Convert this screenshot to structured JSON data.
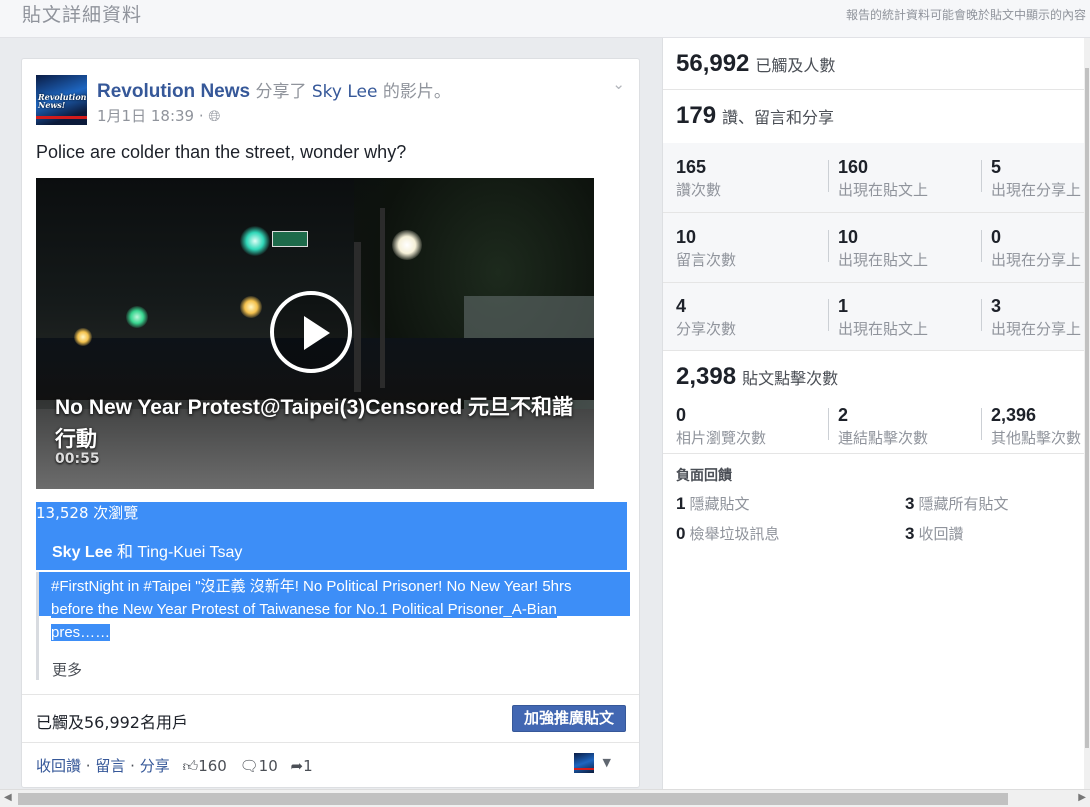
{
  "header": {
    "title": "貼文詳細資料",
    "note": "報告的統計資料可能會晚於貼文中顯示的內容"
  },
  "post": {
    "page_name": "Revolution News",
    "shared_text": "分享了",
    "shared_user": "Sky Lee",
    "shared_suffix": "的影片。",
    "date": "1月1日 18:39 ·",
    "message": "Police are colder than the street, wonder why?",
    "avatar_text": "Revolution\nNews!",
    "video": {
      "title": "No New Year Protest@Taipei(3)Censored 元旦不和諧行動",
      "duration": "00:55",
      "views": "13,528 次瀏覽"
    },
    "tagged": {
      "first": "Sky Lee",
      "joiner": "和",
      "second": "Ting-Kuei Tsay"
    },
    "description_line1": "#FirstNight in #Taipei \"沒正義 沒新年! No Political Prisoner! No New Year! 5hrs",
    "description_line2": "before the New Year Protest of Taiwanese for No.1 Political Prisoner_A-Bian",
    "description_line3": "pres……",
    "more": "更多",
    "reach": "已觸及56,992名用戶",
    "boost_label": "加強推廣貼文",
    "actions": {
      "unlike": "收回讚",
      "comment": "留言",
      "share": "分享",
      "sep": "·",
      "likes": "160",
      "comments": "10",
      "shares": "1"
    }
  },
  "stats": {
    "reach": {
      "value": "56,992",
      "label": "已觸及人數"
    },
    "engagement": {
      "value": "179",
      "label": "讚、留言和分享"
    },
    "likes": {
      "total": {
        "value": "165",
        "label": "讚次數"
      },
      "on_post": {
        "value": "160",
        "label": "出現在貼文上"
      },
      "on_shares": {
        "value": "5",
        "label": "出現在分享上"
      }
    },
    "comments": {
      "total": {
        "value": "10",
        "label": "留言次數"
      },
      "on_post": {
        "value": "10",
        "label": "出現在貼文上"
      },
      "on_shares": {
        "value": "0",
        "label": "出現在分享上"
      }
    },
    "shares": {
      "total": {
        "value": "4",
        "label": "分享次數"
      },
      "on_post": {
        "value": "1",
        "label": "出現在貼文上"
      },
      "on_shares": {
        "value": "3",
        "label": "出現在分享上"
      }
    },
    "clicks": {
      "value": "2,398",
      "label": "貼文點擊次數",
      "photo": {
        "value": "0",
        "label": "相片瀏覽次數"
      },
      "link": {
        "value": "2",
        "label": "連結點擊次數"
      },
      "other": {
        "value": "2,396",
        "label": "其他點擊次數"
      }
    },
    "negative": {
      "title": "負面回饋",
      "hide_post": {
        "value": "1",
        "label": "隱藏貼文"
      },
      "hide_all": {
        "value": "3",
        "label": "隱藏所有貼文"
      },
      "report_spam": {
        "value": "0",
        "label": "檢舉垃圾訊息"
      },
      "unlike_page": {
        "value": "3",
        "label": "收回讚"
      }
    }
  },
  "colors": {
    "link": "#365899",
    "boost": "#4267b2",
    "selection": "#3d8ef7",
    "muted": "#90949c"
  }
}
